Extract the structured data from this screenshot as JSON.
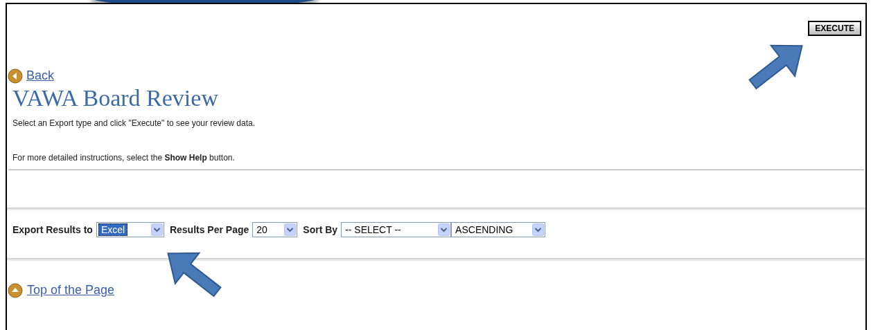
{
  "execute_button": {
    "label": "EXECUTE"
  },
  "back_link": {
    "label": "Back"
  },
  "title": "VAWA Board Review",
  "instructions": [
    "Select an Export type and click \"Execute\" to see your review data.",
    "For more detailed instructions, select the **Show Help** button."
  ],
  "controls": [
    {
      "label": "Export Results to",
      "value": "Excel",
      "highlighted": true
    },
    {
      "label": "Results Per Page",
      "value": "20",
      "highlighted": false
    },
    {
      "label": "Sort By",
      "value": "-- SELECT --",
      "highlighted": false
    },
    {
      "value": "ASCENDING",
      "highlighted": false
    }
  ],
  "top_link": {
    "label": "Top of the Page"
  }
}
